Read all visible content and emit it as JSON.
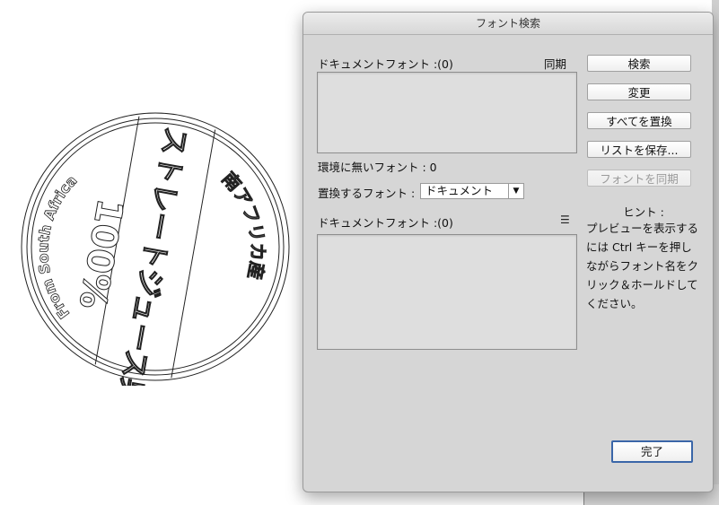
{
  "artwork": {
    "left_text": "From South Africa",
    "right_text": "南アフリカ産",
    "center_percent": "100%",
    "band_text": "ストレートジュース果汁"
  },
  "dialog": {
    "title": "フォント検索",
    "document_fonts_label": "ドキュメントフォント :(0)",
    "sync_label": "同期",
    "missing_fonts_label": "環境に無いフォント : 0",
    "replace_font_label": "置換するフォント :",
    "replace_font_value": "ドキュメント",
    "document_fonts_label_2": "ドキュメントフォント :(0)",
    "list_icon": "list-icon",
    "buttons": {
      "search": "検索",
      "change": "変更",
      "replace_all": "すべてを置換",
      "save_list": "リストを保存...",
      "sync_font": "フォントを同期",
      "done": "完了"
    },
    "hint_title": "ヒント :",
    "hint_body": "プレビューを表示するには Ctrl キーを押しながらフォント名をクリック＆ホールドしてください。"
  }
}
